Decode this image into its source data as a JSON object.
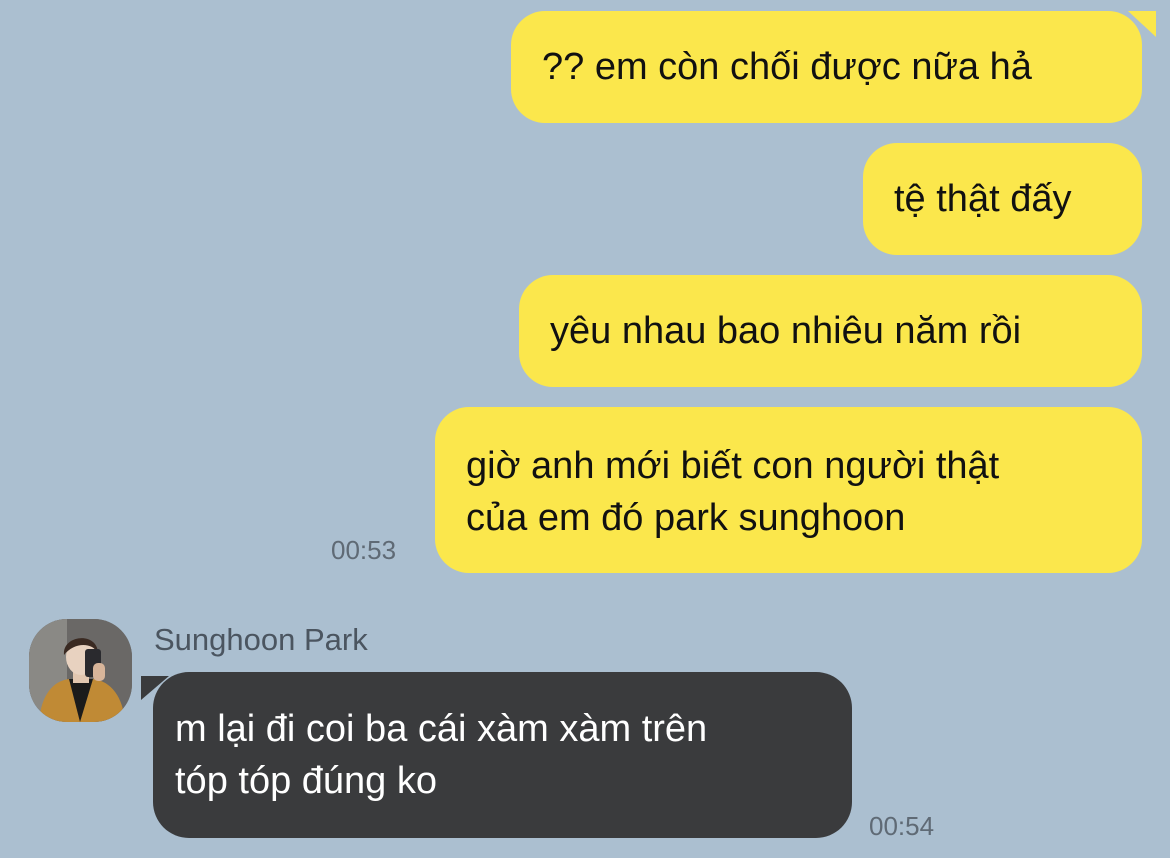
{
  "outgoing": {
    "messages": [
      {
        "lines": [
          "?? em còn chối được nữa hả"
        ]
      },
      {
        "lines": [
          "tệ thật đấy"
        ]
      },
      {
        "lines": [
          "yêu nhau bao nhiêu năm rồi"
        ]
      },
      {
        "lines": [
          "giờ anh mới biết con người thật",
          "của em đó park sunghoon"
        ]
      }
    ],
    "timestamp": "00:53"
  },
  "incoming": {
    "sender": "Sunghoon Park",
    "avatar_icon": "profile-photo",
    "lines": [
      "m lại đi coi ba cái xàm xàm trên",
      "tóp tóp đúng ko"
    ],
    "timestamp": "00:54"
  },
  "colors": {
    "background": "#abbfd0",
    "outgoing_bubble": "#fbe74c",
    "incoming_bubble": "#3a3b3d",
    "timestamp_text": "#5f6a75"
  }
}
